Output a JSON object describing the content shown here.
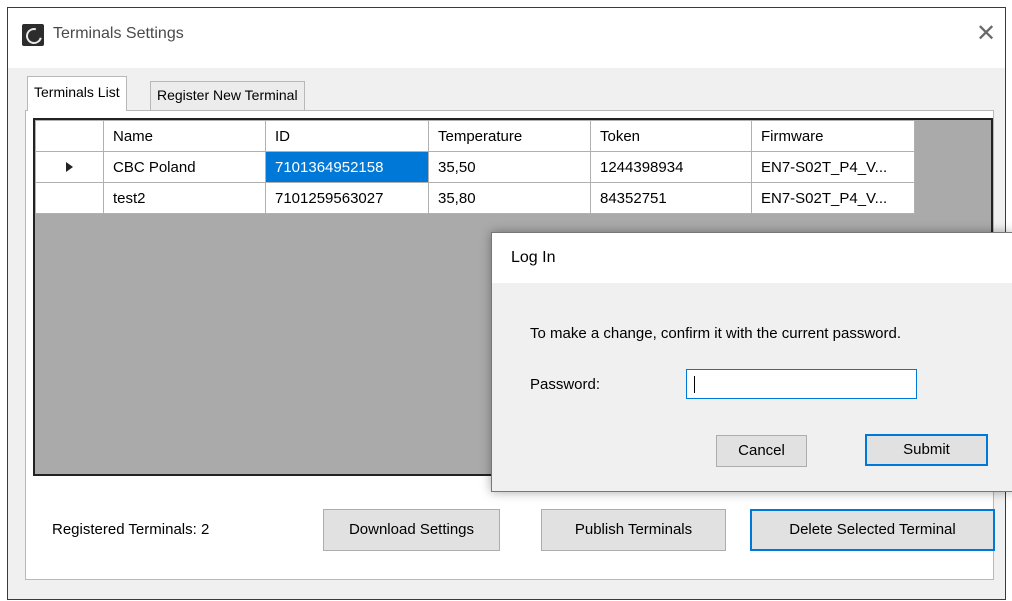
{
  "window": {
    "title": "Terminals Settings",
    "icon": "app-logo-icon",
    "close_icon": "close-icon"
  },
  "tabs": [
    {
      "label": "Terminals List",
      "active": true
    },
    {
      "label": "Register New Terminal",
      "active": false
    }
  ],
  "grid": {
    "columns": [
      "Name",
      "ID",
      "Temperature",
      "Token",
      "Firmware"
    ],
    "rows": [
      {
        "current": true,
        "cells": [
          "CBC Poland",
          "7101364952158",
          "35,50",
          "1244398934",
          "EN7-S02T_P4_V..."
        ]
      },
      {
        "current": false,
        "cells": [
          "test2",
          "7101259563027",
          "35,80",
          "84352751",
          "EN7-S02T_P4_V..."
        ]
      }
    ],
    "selected_cell": {
      "row": 0,
      "column": 1
    }
  },
  "footer": {
    "count_label": "Registered Terminals: 2",
    "download_button": "Download Settings",
    "publish_button": "Publish Terminals",
    "delete_button": "Delete Selected Terminal"
  },
  "dialog": {
    "title": "Log In",
    "message": "To make a change, confirm it with the current password.",
    "password_label": "Password:",
    "password_value": "",
    "cancel_button": "Cancel",
    "submit_button": "Submit"
  },
  "colors": {
    "accent": "#0078d7",
    "grid_background": "#aaaaaa",
    "window_background": "#f0f0f0"
  }
}
